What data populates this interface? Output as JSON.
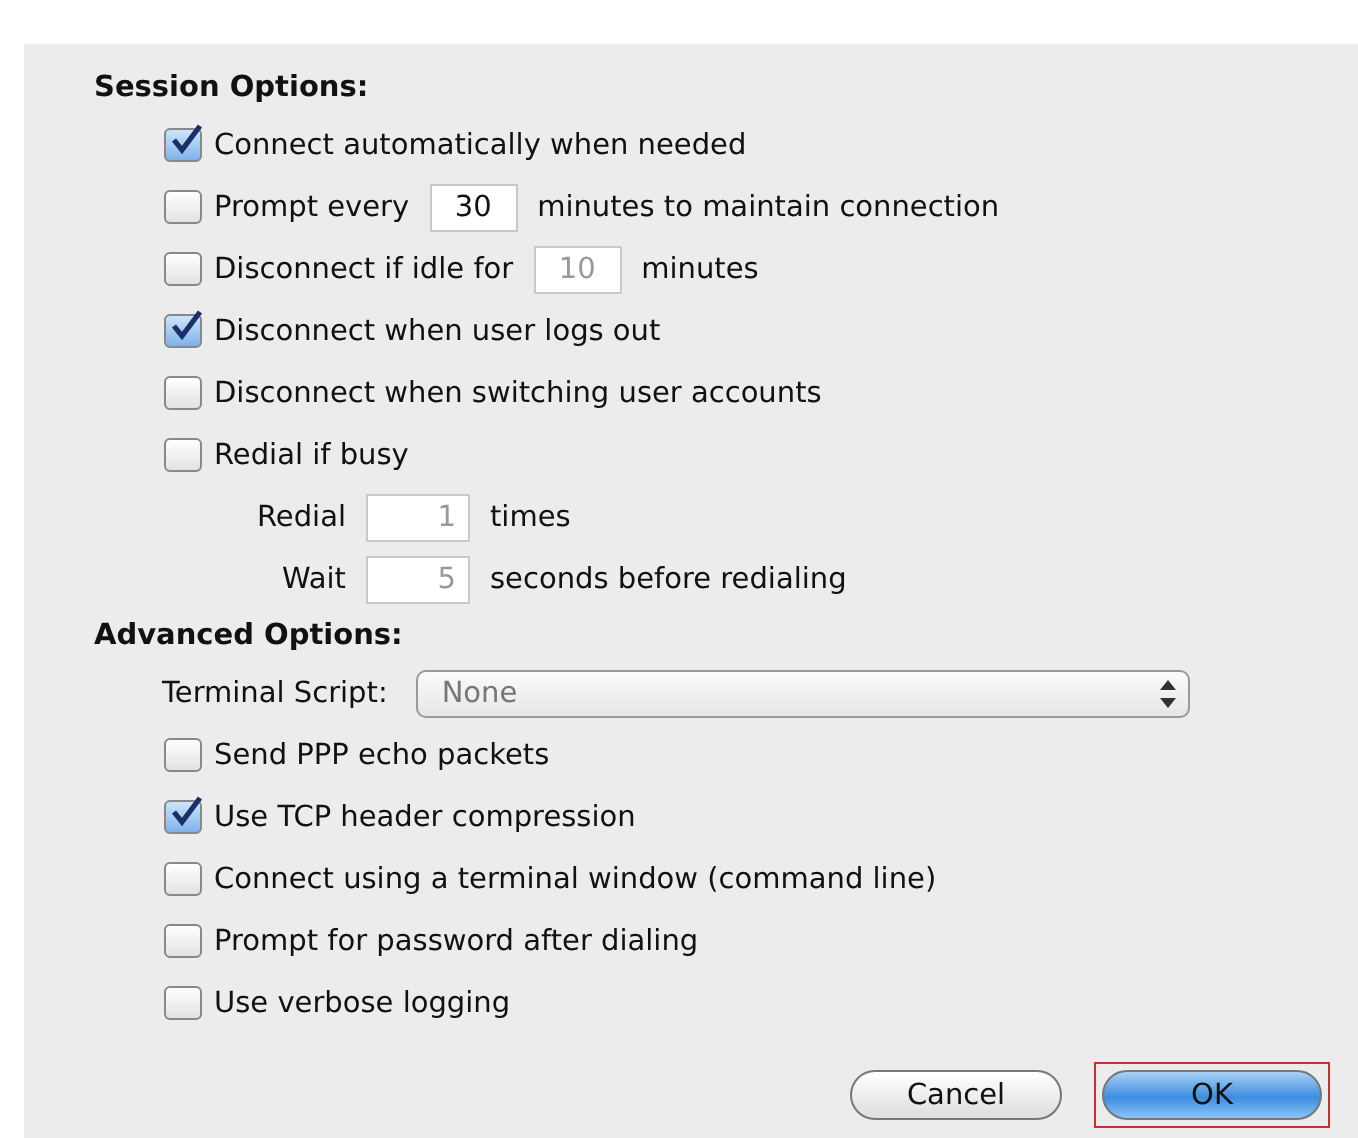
{
  "sections": [
    {
      "title": "Session Options:",
      "items": [
        {
          "kind": "checkbox",
          "label": "Connect automatically when needed",
          "checked": true
        },
        {
          "kind": "checkbox_field",
          "checked": false,
          "before": "Prompt every",
          "value": "30",
          "after": "minutes to maintain connection",
          "disabled": false
        },
        {
          "kind": "checkbox_field",
          "checked": false,
          "before": "Disconnect if idle for",
          "value": "10",
          "after": "minutes",
          "disabled": true
        },
        {
          "kind": "checkbox",
          "label": "Disconnect when user logs out",
          "checked": true
        },
        {
          "kind": "checkbox",
          "label": "Disconnect when switching user accounts",
          "checked": false
        },
        {
          "kind": "checkbox",
          "label": "Redial if busy",
          "checked": false
        },
        {
          "kind": "field",
          "before": "Redial",
          "value": "1",
          "after": "times",
          "disabled": true
        },
        {
          "kind": "field",
          "before": "Wait",
          "value": "5",
          "after": "seconds before redialing",
          "disabled": true
        }
      ]
    },
    {
      "title": "Advanced Options:",
      "items": [
        {
          "kind": "select",
          "label": "Terminal Script:",
          "value": "None"
        },
        {
          "kind": "checkbox",
          "label": "Send PPP echo packets",
          "checked": false
        },
        {
          "kind": "checkbox",
          "label": "Use TCP header compression",
          "checked": true
        },
        {
          "kind": "checkbox",
          "label": "Connect using a terminal window (command line)",
          "checked": false
        },
        {
          "kind": "checkbox",
          "label": "Prompt for password after dialing",
          "checked": false
        },
        {
          "kind": "checkbox",
          "label": "Use verbose logging",
          "checked": false
        }
      ]
    }
  ],
  "buttons": [
    {
      "label": "Cancel",
      "default": false,
      "highlighted": false
    },
    {
      "label": "OK",
      "default": true,
      "highlighted": true
    }
  ]
}
